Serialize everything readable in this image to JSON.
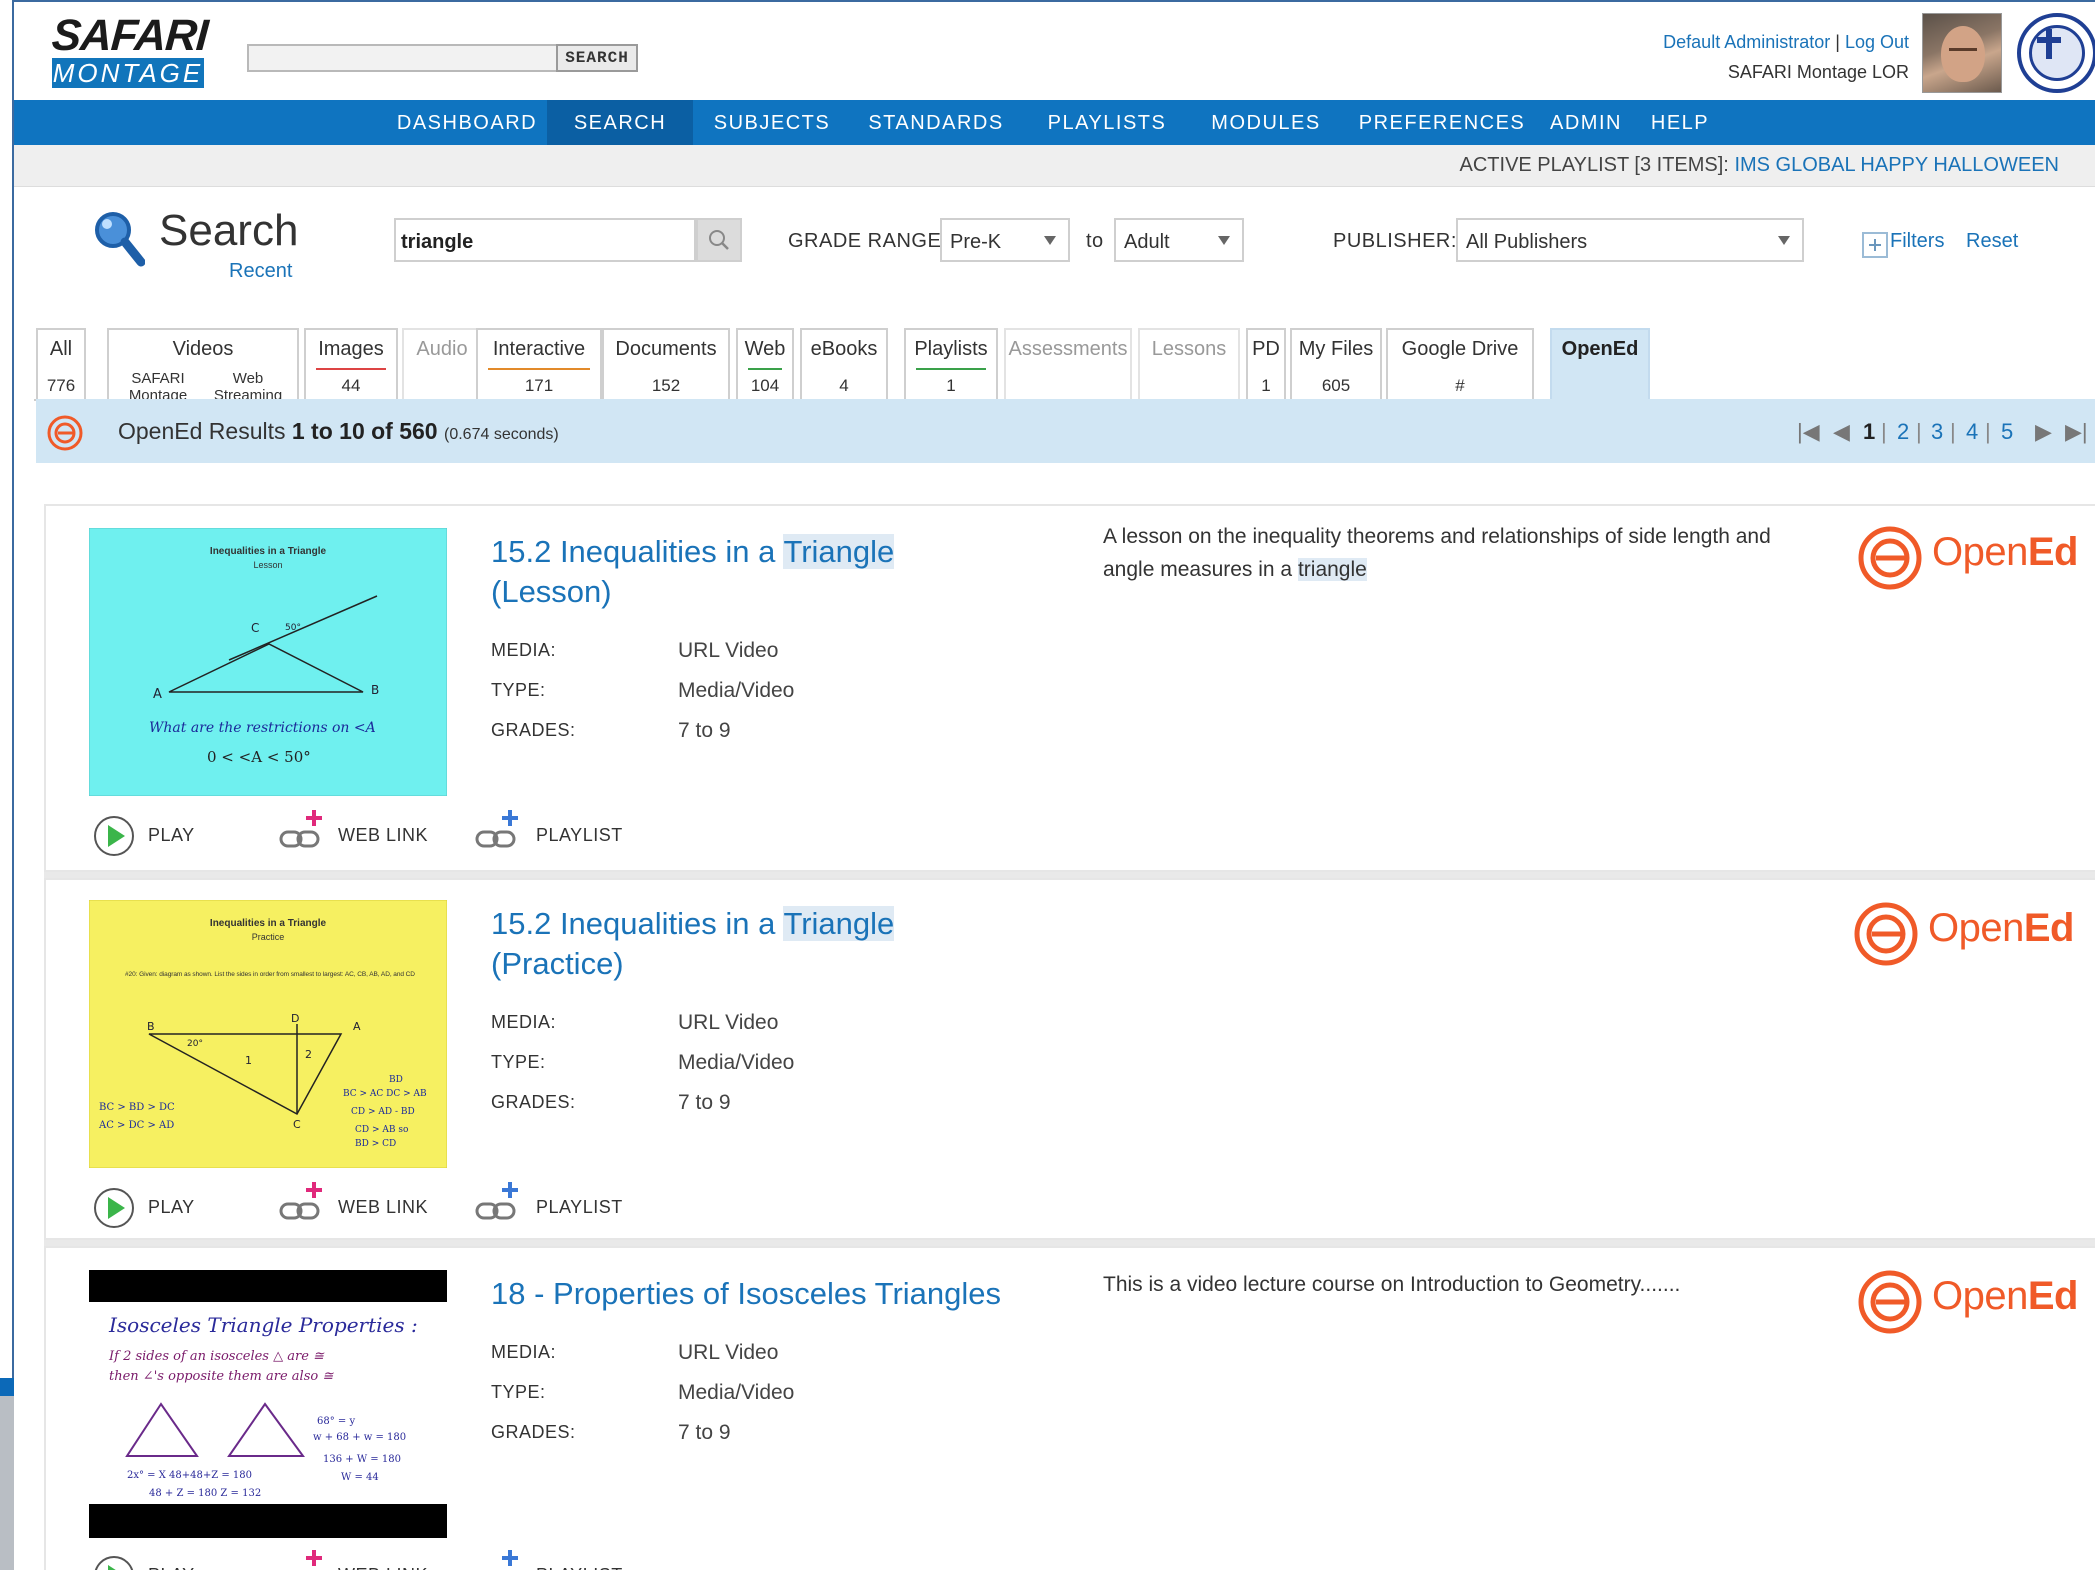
{
  "header": {
    "logo_line1": "SAFARI",
    "logo_line2": "MONTAGE",
    "search_button": "SEARCH",
    "user_name": "Default Administrator",
    "separator": "|",
    "logout": "Log Out",
    "site_name": "SAFARI Montage LOR"
  },
  "nav": [
    "DASHBOARD",
    "SEARCH",
    "SUBJECTS",
    "STANDARDS",
    "PLAYLISTS",
    "MODULES",
    "PREFERENCES",
    "ADMIN",
    "HELP"
  ],
  "playlist_bar": {
    "label": "ACTIVE PLAYLIST [3 ITEMS]:",
    "name": "IMS GLOBAL HAPPY HALLOWEEN"
  },
  "search": {
    "title": "Search",
    "recent": "Recent",
    "query": "triangle",
    "grade_label": "GRADE RANGE:",
    "grade_from": "Pre-K",
    "to": "to",
    "grade_to": "Adult",
    "publisher_label": "PUBLISHER:",
    "publisher": "All Publishers",
    "filters": "Filters",
    "reset": "Reset"
  },
  "tabs": [
    {
      "label": "All",
      "count": "776"
    },
    {
      "label": "Videos",
      "sub1": "SAFARI Montage",
      "sub2": "Web Streaming"
    },
    {
      "label": "Images",
      "count": "44"
    },
    {
      "label": "Audio",
      "count": ""
    },
    {
      "label": "Interactive",
      "count": "171"
    },
    {
      "label": "Documents",
      "count": "152"
    },
    {
      "label": "Web",
      "count": "104"
    },
    {
      "label": "eBooks",
      "count": "4"
    },
    {
      "label": "Playlists",
      "count": "1"
    },
    {
      "label": "Assessments",
      "count": ""
    },
    {
      "label": "Lessons",
      "count": ""
    },
    {
      "label": "PD",
      "count": "1"
    },
    {
      "label": "My Files",
      "count": "605"
    },
    {
      "label": "Google Drive",
      "count": "#"
    },
    {
      "label": "OpenEd",
      "count": ""
    }
  ],
  "results": {
    "prefix": "OpenEd Results",
    "range": "1 to 10 of 560",
    "time": "(0.674 seconds)",
    "pages": [
      "1",
      "2",
      "3",
      "4",
      "5"
    ],
    "sep": "|"
  },
  "meta_labels": {
    "media": "MEDIA:",
    "type": "TYPE:",
    "grades": "GRADES:"
  },
  "actions": {
    "play": "PLAY",
    "weblink": "WEB LINK",
    "playlist": "PLAYLIST"
  },
  "items": [
    {
      "title_pre": "15.2 Inequalities in a ",
      "title_hl": "Triangle",
      "title_post": "(Lesson)",
      "media": "URL Video",
      "type": "Media/Video",
      "grades": "7 to 9",
      "desc_pre": "A lesson on the inequality theorems and relationships of side length and angle measures in a ",
      "desc_hl": "triangle",
      "thumb_title": "Inequalities in a Triangle",
      "thumb_sub": "Lesson",
      "thumb_text1": "What are the restrictions on <A",
      "thumb_text2": "0 < <A < 50°",
      "thumb_labels": [
        "A",
        "B",
        "C",
        "50°"
      ]
    },
    {
      "title_pre": "15.2 Inequalities in a ",
      "title_hl": "Triangle",
      "title_post": "(Practice)",
      "media": "URL Video",
      "type": "Media/Video",
      "grades": "7 to 9",
      "thumb_title": "Inequalities in a Triangle",
      "thumb_sub": "Practice",
      "thumb_prompt": "#20: Given: diagram as shown. List the sides in order from smallest to largest: AC, CB, AB, AD, and CD",
      "thumb_notes": [
        "BC > AC  DC > AB",
        "BD",
        "CD > AD - BD",
        "CD > AB so",
        "BD > CD",
        "BC > BD > DC",
        "AC > DC > AD"
      ],
      "thumb_labels": [
        "B",
        "D",
        "A",
        "C",
        "20°",
        "1",
        "2"
      ]
    },
    {
      "title_pre": "18 - Properties of Isosceles Triangles",
      "media": "URL Video",
      "type": "Media/Video",
      "grades": "7 to 9",
      "desc_pre": "This is a video lecture course on Introduction to Geometry.......",
      "thumb_title": "Isosceles Triangle Properties :",
      "thumb_l1": "If 2 sides of an isosceles △ are ≅",
      "thumb_l2": "then ∠'s opposite them are also ≅",
      "thumb_notes": [
        "68° = y",
        "w + 68 + w = 180",
        "136 + W = 180",
        "W = 44",
        "2x° = X  48+48+Z = 180",
        "48 + Z = 180  Z = 132"
      ]
    }
  ],
  "opened_logo": {
    "light": "Open",
    "bold": "Ed"
  },
  "colors": {
    "brand_blue": "#0f74c0",
    "opened_orange": "#f05a28",
    "results_bg": "#d1e6f4",
    "link": "#1a73b8"
  }
}
